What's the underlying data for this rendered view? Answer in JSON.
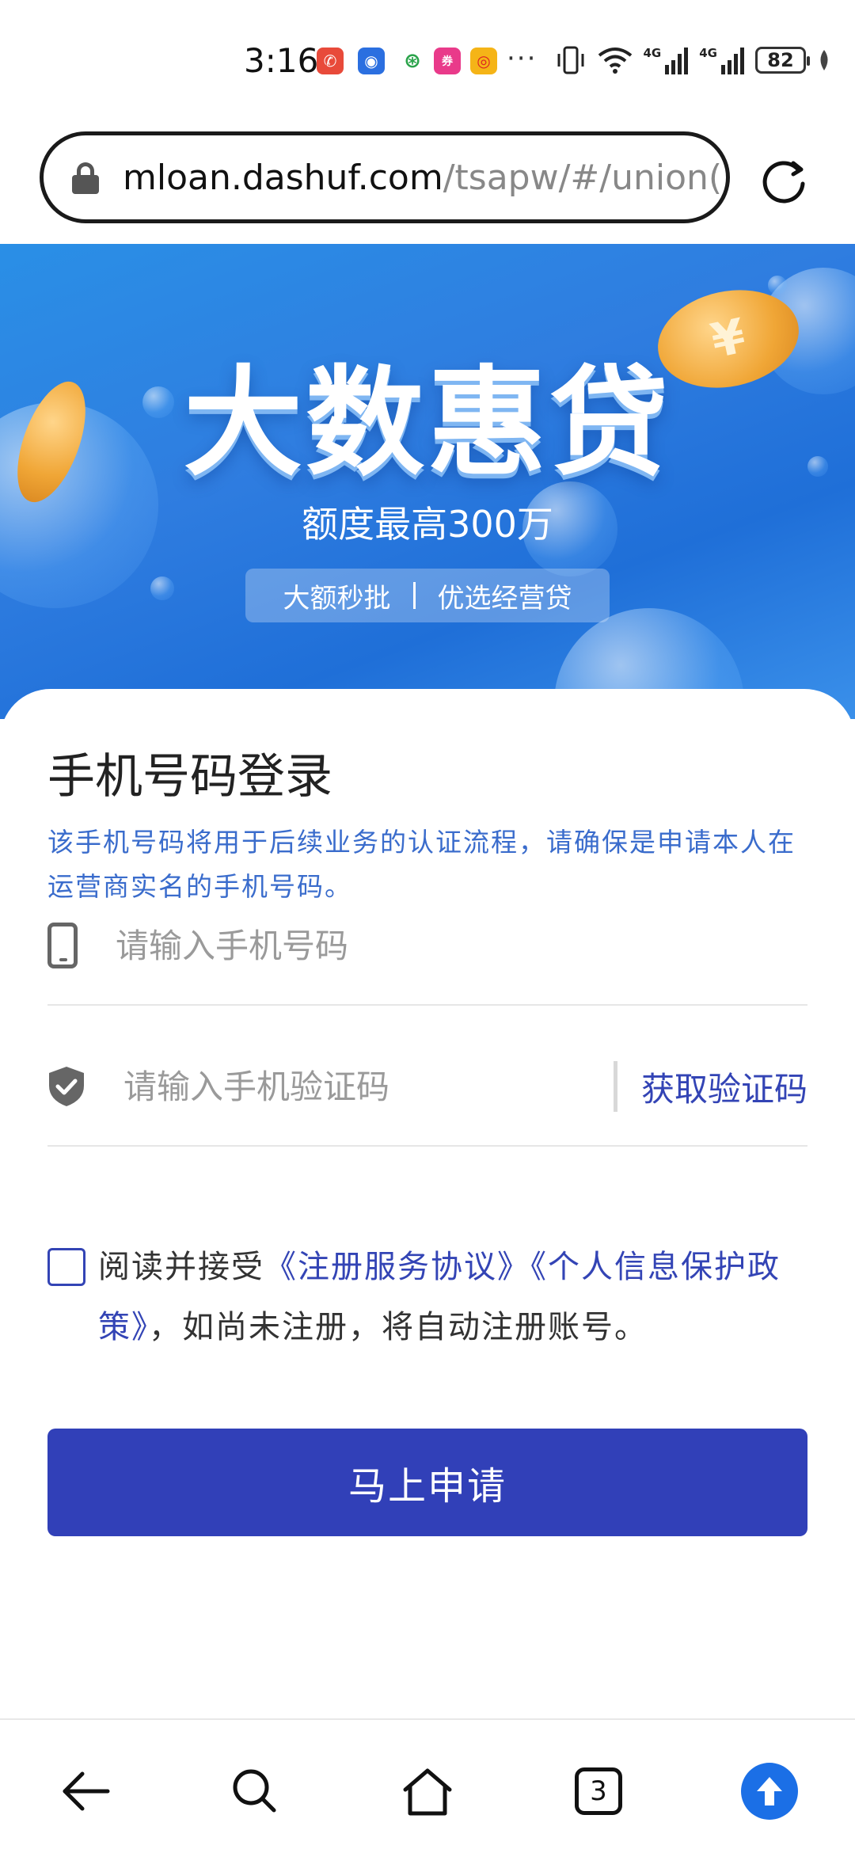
{
  "status_bar": {
    "time": "3:16",
    "battery": "82",
    "overflow": "···",
    "network_label_1": "4G",
    "network_label_2": "4G",
    "icons": [
      "missed-call-icon",
      "app-icon",
      "mobile-carrier-icon",
      "shopping-app-icon",
      "weibo-icon",
      "vibrate-icon",
      "wifi-icon",
      "signal-icon",
      "signal-icon",
      "battery-icon",
      "leaf-icon"
    ]
  },
  "address_bar": {
    "host": "mloan.dashuf.com",
    "path": "/tsapw/#/union("
  },
  "banner": {
    "title": "大数惠贷",
    "subtitle": "额度最高300万",
    "tag_left": "大额秒批",
    "tag_right": "优选经营贷",
    "coin_symbol": "¥"
  },
  "login": {
    "title": "手机号码登录",
    "description": "该手机号码将用于后续业务的认证流程，请确保是申请本人在运营商实名的手机号码。",
    "phone_placeholder": "请输入手机号码",
    "code_placeholder": "请输入手机验证码",
    "get_code_label": "获取验证码",
    "agree_prefix": "阅读并接受",
    "agreement_link": "《注册服务协议》",
    "privacy_link": "《个人信息保护政策》",
    "agree_suffix": "，如尚未注册，将自动注册账号。",
    "submit_label": "马上申请"
  },
  "bottom_nav": {
    "tab_count": "3",
    "items": [
      "back-icon",
      "search-icon",
      "home-icon",
      "tabs-icon",
      "upload-icon"
    ]
  },
  "colors": {
    "accent": "#3140b8",
    "link": "#3344b5",
    "desc_text": "#3a6ccc",
    "banner_blue": "#2a8fe6"
  }
}
